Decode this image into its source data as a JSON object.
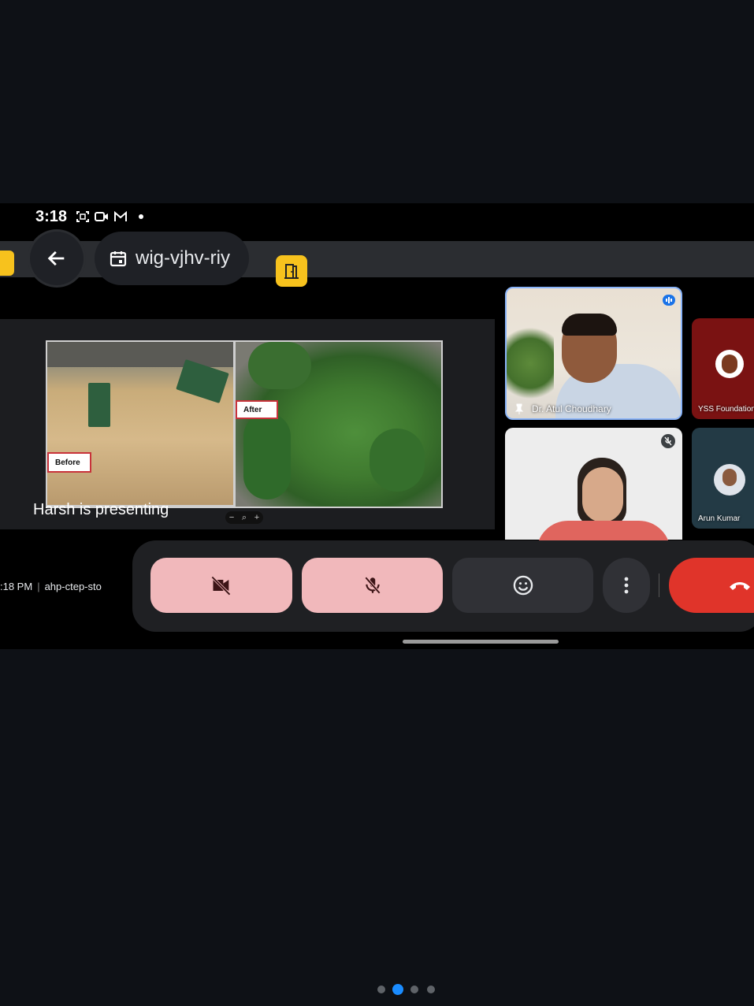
{
  "status_bar": {
    "time": "3:18",
    "icons": [
      "screenshot-icon",
      "video-camera-icon",
      "gmail-icon",
      "notification-dot-icon"
    ]
  },
  "meeting": {
    "code": "wig-vjhv-riy",
    "presenting_text": "Harsh is presenting",
    "slide": {
      "before_label": "Before",
      "after_label": "After"
    },
    "zoom_controls": {
      "minus": "−",
      "zoom": "⌕",
      "plus": "+"
    },
    "footer_time": ":18 PM",
    "footer_code": "ahp-ctep-sto"
  },
  "participants": [
    {
      "name": "Dr. Atul Choudhary",
      "pinned": true,
      "speaking": true
    },
    {
      "name": "",
      "muted": true
    },
    {
      "name": "YSS Foundation"
    },
    {
      "name": "Arun Kumar"
    }
  ],
  "controls": {
    "camera": "camera-off-icon",
    "mic": "mic-off-icon",
    "reactions": "emoji-icon",
    "more": "more-vert-icon",
    "end": "call-end-icon"
  },
  "colors": {
    "accent_blue": "#8ab4f8",
    "muted_button": "#f1b8bb",
    "end_call": "#e0342a",
    "exit_button": "#f7c21d",
    "page_dot_active": "#1a8cff"
  },
  "pager": {
    "count": 4,
    "active_index": 1
  }
}
